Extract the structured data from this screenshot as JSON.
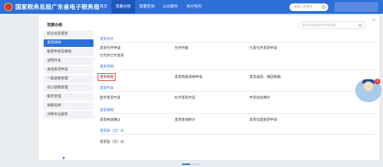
{
  "header": {
    "site_title": "国家税务总局广东省电子税务局",
    "nav": [
      "首页",
      "我要办税",
      "我要查询",
      "公众服务",
      "地方特色"
    ],
    "search_placeholder": "请输入关键词"
  },
  "sidebar": {
    "title": "我要办税",
    "items": [
      "综合信息报告",
      "发票使用",
      "税费申报及缴纳",
      "证明开具",
      "其他事项申请",
      "一般退税管理",
      "出口退税管理",
      "税务管理",
      "纳税信用",
      "涉税专业服务"
    ]
  },
  "content": {
    "search_placeholder": "搜索要办理的事项或功能",
    "sections": [
      {
        "title": "发票代开",
        "links": [
          "发票代开申请",
          "代开作废",
          "已发代开发票申请",
          "已代开已开发票"
        ]
      },
      {
        "title": "发票领用",
        "links": [
          "发票领用",
          "发票简易领用申请",
          "发票退回、赎回核销"
        ]
      },
      {
        "title": "发票开具",
        "links": [
          "蓝字发票开具",
          "红字发票开具",
          "开票信息维护"
        ]
      },
      {
        "title": "发票使用",
        "links": [
          "发票用途确认",
          "发票查询统计",
          "发票勾选变更申请"
        ]
      },
      {
        "title": "发票验（文）白",
        "links": [
          "发票验（文）白"
        ]
      }
    ]
  },
  "colors": {
    "primary": "#2e6fd8",
    "highlight": "#e53935"
  },
  "icons": [
    "emblem-icon",
    "search-icon",
    "close-icon",
    "chevron-down-icon",
    "assistant-mascot-icon"
  ]
}
